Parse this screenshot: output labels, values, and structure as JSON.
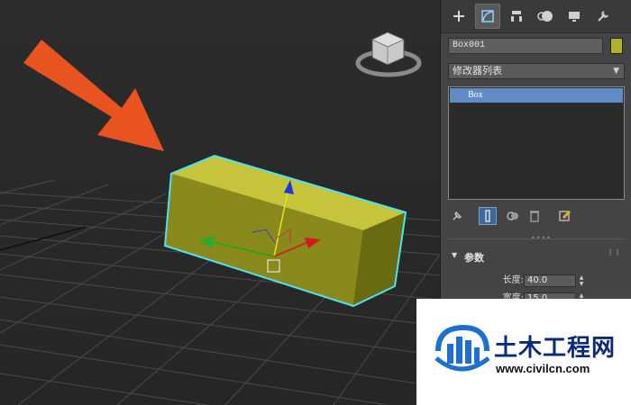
{
  "object_name": "Box001",
  "modifier_list": {
    "label": "修改器列表",
    "arrow": "▼"
  },
  "modifier_stack": {
    "items": [
      "Box"
    ]
  },
  "parameters_rollout": {
    "title": "参数",
    "fields": [
      {
        "label": "长度:",
        "value": "40.0"
      },
      {
        "label": "宽度:",
        "value": "15.0"
      }
    ]
  },
  "watermark": {
    "name": "土木工程网",
    "url": "www.civilcn.com"
  },
  "colors": {
    "object_color": "#b3b227",
    "selection_outline": "#4fe3f0",
    "annotation_arrow": "#e8531f",
    "stack_highlight": "#5f8cc7"
  },
  "icons": {
    "tabs": [
      "create-icon",
      "modify-icon",
      "hierarchy-icon",
      "motion-icon",
      "display-icon",
      "utilities-icon"
    ],
    "stack_tools": [
      "pin-stack-icon",
      "show-end-result-icon",
      "make-unique-icon",
      "remove-modifier-icon",
      "configure-modifier-sets-icon"
    ]
  }
}
